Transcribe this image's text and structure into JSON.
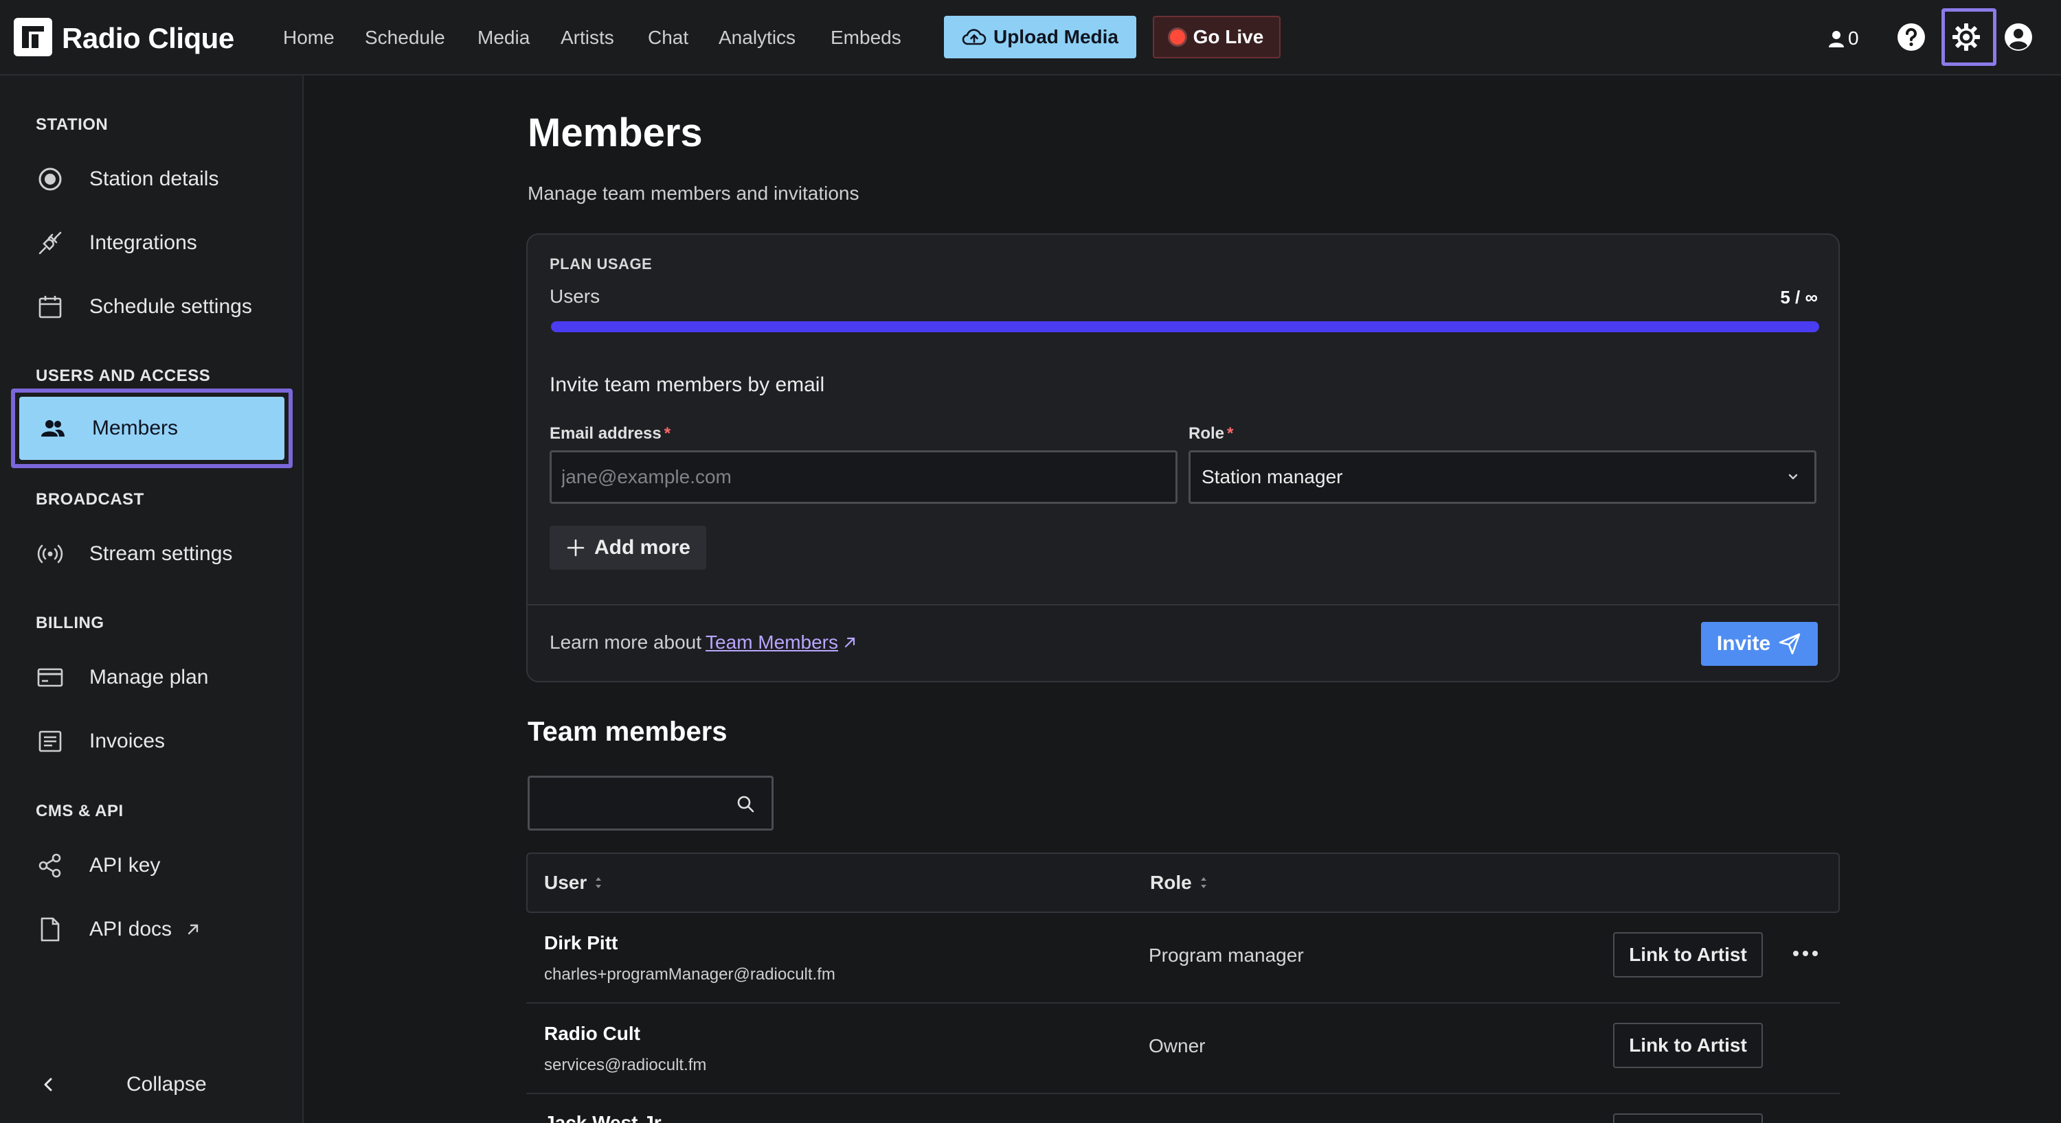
{
  "app": {
    "brand": "Radio Clique",
    "nav": [
      "Home",
      "Schedule",
      "Media",
      "Artists",
      "Chat",
      "Analytics",
      "Embeds"
    ],
    "upload_label": "Upload Media",
    "golive_label": "Go Live",
    "listener_count": "0"
  },
  "colors": {
    "accent": "#93d2f7",
    "highlight_frame": "#7b67d9",
    "progress": "#4a3cf0",
    "invite_button": "#4f8df2",
    "live_dot": "#ff4a3a"
  },
  "sidebar": {
    "sections": [
      {
        "heading": "STATION",
        "items": [
          {
            "label": "Station details",
            "icon": "radio-button-icon"
          },
          {
            "label": "Integrations",
            "icon": "plug-icon"
          },
          {
            "label": "Schedule settings",
            "icon": "calendar-icon"
          }
        ]
      },
      {
        "heading": "USERS AND ACCESS",
        "items": [
          {
            "label": "Members",
            "icon": "users-icon",
            "active": true
          }
        ]
      },
      {
        "heading": "BROADCAST",
        "items": [
          {
            "label": "Stream settings",
            "icon": "broadcast-icon"
          }
        ]
      },
      {
        "heading": "BILLING",
        "items": [
          {
            "label": "Manage plan",
            "icon": "credit-card-icon"
          },
          {
            "label": "Invoices",
            "icon": "receipt-icon"
          }
        ]
      },
      {
        "heading": "CMS & API",
        "items": [
          {
            "label": "API key",
            "icon": "share-nodes-icon"
          },
          {
            "label": "API docs",
            "icon": "document-icon",
            "external": true
          }
        ]
      }
    ],
    "collapse_label": "Collapse"
  },
  "page": {
    "title": "Members",
    "subtitle": "Manage team members and invitations"
  },
  "plan_usage": {
    "heading": "PLAN USAGE",
    "users_label": "Users",
    "count": "5 / ∞",
    "progress_fraction": 1.0
  },
  "invite": {
    "title": "Invite team members by email",
    "email_label": "Email address",
    "email_placeholder": "jane@example.com",
    "email_value": "",
    "role_label": "Role",
    "role_value": "Station manager",
    "required_mark": "*",
    "add_more_label": "Add more",
    "learn_more_prefix": "Learn more about",
    "learn_more_link": "Team Members",
    "invite_label": "Invite"
  },
  "team": {
    "title": "Team members",
    "search_value": "",
    "columns": {
      "user": "User",
      "role": "Role"
    },
    "link_label": "Link to Artist",
    "rows": [
      {
        "name": "Dirk Pitt",
        "email": "charles+programManager@radiocult.fm",
        "role": "Program manager",
        "has_menu": true
      },
      {
        "name": "Radio Cult",
        "email": "services@radiocult.fm",
        "role": "Owner",
        "has_menu": false
      },
      {
        "name": "Jack West Jr",
        "email": "",
        "role": "",
        "has_menu": false
      }
    ]
  }
}
